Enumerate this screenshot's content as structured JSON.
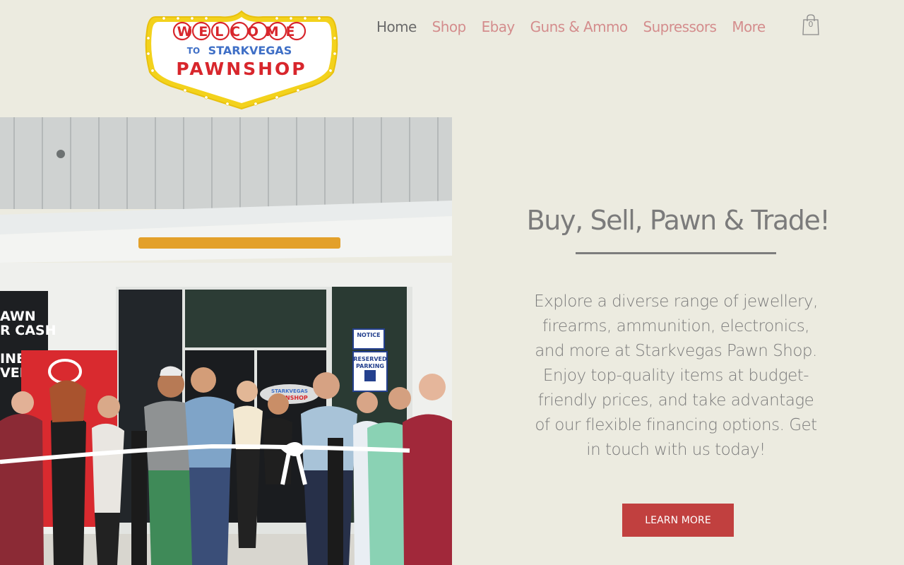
{
  "logo": {
    "line1": "WELCOME",
    "line2_prefix": "TO",
    "line2_name": "STARKVEGAS",
    "line3": "PAWNSHOP",
    "colors": {
      "frame": "#f3d21c",
      "red": "#d8262c",
      "blue": "#3f6fc6"
    }
  },
  "nav": {
    "items": [
      {
        "label": "Home",
        "active": true
      },
      {
        "label": "Shop"
      },
      {
        "label": "Ebay"
      },
      {
        "label": "Guns & Ammo"
      },
      {
        "label": "Supressors"
      },
      {
        "label": "More"
      }
    ],
    "colors": {
      "active": "#6b6b6b",
      "link": "#d48d8d"
    }
  },
  "cart": {
    "count": "0",
    "icon": "shopping-bag-icon"
  },
  "hero": {
    "photo": {
      "storefront_sign_lines": [
        "AWN",
        "R CASH",
        "INE",
        "VELI"
      ],
      "notice_sign": "NOTICE",
      "reserved_sign": [
        "RESERVED",
        "PARKING"
      ],
      "door_logo": [
        "STARKVEGAS",
        "PAWNSHOP"
      ]
    },
    "headline": "Buy, Sell, Pawn & Trade!",
    "body": "Explore a diverse range of jewellery, firearms, ammunition, electronics, and more at Starkvegas Pawn Shop. Enjoy top-quality items at budget-friendly prices, and take advantage of our flexible financing options. Get in touch with us today!",
    "cta_label": "LEARN MORE",
    "colors": {
      "background": "#ecebe0",
      "text": "#7b7b7b",
      "cta": "#c1403f"
    }
  }
}
